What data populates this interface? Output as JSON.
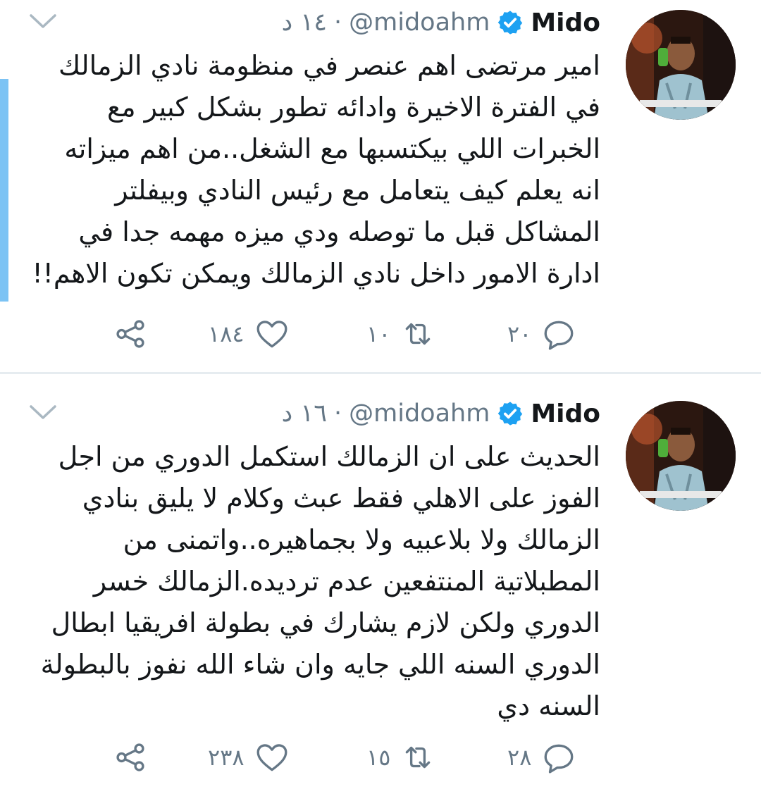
{
  "tweets": [
    {
      "author_name": "Mido",
      "handle": "@midoahm",
      "separator": "·",
      "time": "١٤ د",
      "text_lines": [
        "امير مرتضى اهم عنصر في منظومة نادي الزمالك",
        "في الفترة الاخيرة وادائه تطور بشكل كبير مع",
        "الخبرات اللي بيكتسبها مع الشغل..من اهم ميزاته",
        "انه يعلم كيف يتعامل مع رئيس  النادي وبيفلتر",
        "المشاكل قبل ما توصله ودي ميزه مهمه جدا في",
        "ادارة الامور داخل نادي الزمالك ويمكن تكون الاهم!!"
      ],
      "reply_count": "٢٠",
      "retweet_count": "١٠",
      "like_count": "١٨٤"
    },
    {
      "author_name": "Mido",
      "handle": "@midoahm",
      "separator": "·",
      "time": "١٦ د",
      "text_lines": [
        "الحديث على ان الزمالك استكمل الدوري من اجل",
        "الفوز على الاهلي فقط عبث وكلام لا يليق بنادي",
        "الزمالك ولا بلاعبيه ولا بجماهيره..واتمنى من",
        "المطبلاتية المنتفعين عدم ترديده.الزمالك خسر",
        "الدوري ولكن لازم يشارك في بطولة افريقيا ابطال",
        "الدوري السنه اللي جايه وان شاء الله نفوز بالبطولة",
        "السنه دي"
      ],
      "reply_count": "٢٨",
      "retweet_count": "١٥",
      "like_count": "٢٣٨"
    }
  ],
  "icons": {
    "verified": "verified-badge-icon",
    "caret": "chevron-down-icon",
    "reply": "reply-icon",
    "retweet": "retweet-icon",
    "like": "heart-icon",
    "share": "share-icon"
  },
  "colors": {
    "verified_blue": "#1da1f2",
    "secondary_text": "#657786",
    "thread_indicator": "#7cc3f4",
    "separator": "#e6ecf0"
  }
}
